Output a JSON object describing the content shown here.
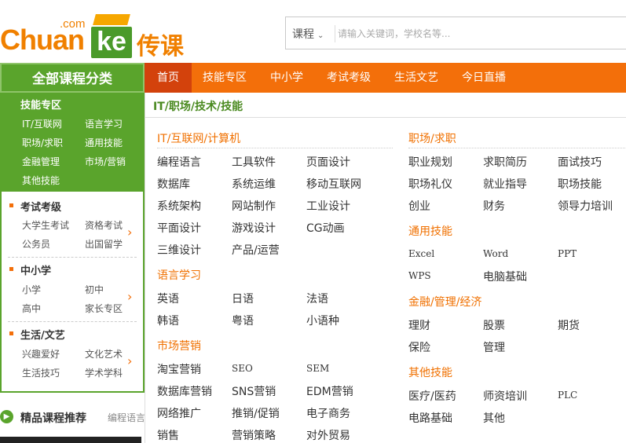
{
  "header": {
    "logo_com": ".com",
    "logo_chuan": "Chuan",
    "logo_ke": "ke",
    "logo_cn": "传课",
    "search_select": "课程",
    "search_placeholder": "请输入关键词，学校名等..."
  },
  "nav": {
    "all_categories": "全部课程分类",
    "items": [
      "首页",
      "技能专区",
      "中小学",
      "考试考级",
      "生活文艺",
      "今日直播"
    ]
  },
  "sidebar": {
    "skills": {
      "title": "技能专区",
      "links": [
        "IT/互联网",
        "语言学习",
        "职场/求职",
        "通用技能",
        "金融管理",
        "市场/营销",
        "其他技能"
      ]
    },
    "exam": {
      "title": "考试考级",
      "links": [
        "大学生考试",
        "资格考试",
        "公务员",
        "出国留学"
      ]
    },
    "k12": {
      "title": "中小学",
      "links": [
        "小学",
        "初中",
        "高中",
        "家长专区"
      ]
    },
    "life": {
      "title": "生活/文艺",
      "links": [
        "兴趣爱好",
        "文化艺术",
        "生活技巧",
        "学术学科"
      ]
    }
  },
  "recommend": {
    "title": "精品课程推荐",
    "sub": "编程语言"
  },
  "panel": {
    "title": "IT/职场/技术/技能",
    "left": [
      {
        "cat": "IT/互联网/计算机",
        "items": [
          "编程语言",
          "工具软件",
          "页面设计",
          "数据库",
          "系统运维",
          "移动互联网",
          "系统架构",
          "网站制作",
          "工业设计",
          "平面设计",
          "游戏设计",
          "CG动画",
          "三维设计",
          "产品/运营"
        ]
      },
      {
        "cat": "语言学习",
        "items": [
          "英语",
          "日语",
          "法语",
          "韩语",
          "粤语",
          "小语种"
        ]
      },
      {
        "cat": "市场营销",
        "items": [
          "淘宝营销",
          "SEO",
          "SEM",
          "数据库营销",
          "SNS营销",
          "EDM营销",
          "网络推广",
          "推销/促销",
          "电子商务",
          "销售",
          "营销策略",
          "对外贸易"
        ]
      }
    ],
    "right": [
      {
        "cat": "职场/求职",
        "items": [
          "职业规划",
          "求职简历",
          "面试技巧",
          "职场礼仪",
          "就业指导",
          "职场技能",
          "创业",
          "财务",
          "领导力培训"
        ]
      },
      {
        "cat": "通用技能",
        "items": [
          "Excel",
          "Word",
          "PPT",
          "WPS",
          "电脑基础"
        ]
      },
      {
        "cat": "金融/管理/经济",
        "items": [
          "理财",
          "股票",
          "期货",
          "保险",
          "管理"
        ]
      },
      {
        "cat": "其他技能",
        "items": [
          "医疗/医药",
          "师资培训",
          "PLC",
          "电路基础",
          "其他"
        ]
      }
    ]
  }
}
